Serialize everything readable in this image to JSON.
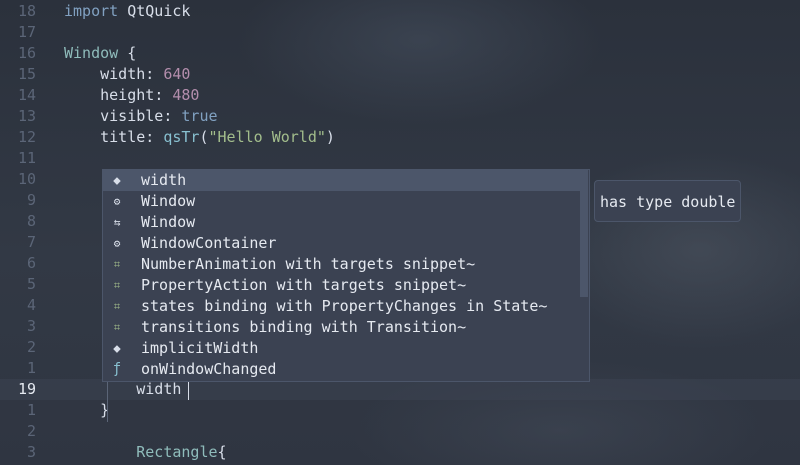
{
  "editor": {
    "lines": [
      {
        "number": "18",
        "tokens": [
          {
            "t": "kw",
            "v": "import"
          },
          {
            "t": "plain",
            "v": " QtQuick"
          }
        ]
      },
      {
        "number": "17",
        "tokens": []
      },
      {
        "number": "16",
        "tokens": [
          {
            "t": "ty",
            "v": "Window"
          },
          {
            "t": "plain",
            "v": " "
          },
          {
            "t": "punc",
            "v": "{"
          }
        ]
      },
      {
        "number": "15",
        "tokens": [
          {
            "t": "plain",
            "v": "    "
          },
          {
            "t": "prop",
            "v": "width"
          },
          {
            "t": "punc",
            "v": ": "
          },
          {
            "t": "num",
            "v": "640"
          }
        ]
      },
      {
        "number": "14",
        "tokens": [
          {
            "t": "plain",
            "v": "    "
          },
          {
            "t": "prop",
            "v": "height"
          },
          {
            "t": "punc",
            "v": ": "
          },
          {
            "t": "num",
            "v": "480"
          }
        ]
      },
      {
        "number": "13",
        "tokens": [
          {
            "t": "plain",
            "v": "    "
          },
          {
            "t": "prop",
            "v": "visible"
          },
          {
            "t": "punc",
            "v": ": "
          },
          {
            "t": "bool",
            "v": "true"
          }
        ]
      },
      {
        "number": "12",
        "tokens": [
          {
            "t": "plain",
            "v": "    "
          },
          {
            "t": "prop",
            "v": "title"
          },
          {
            "t": "punc",
            "v": ": "
          },
          {
            "t": "fn",
            "v": "qsTr"
          },
          {
            "t": "punc",
            "v": "("
          },
          {
            "t": "str",
            "v": "\"Hello World\""
          },
          {
            "t": "punc",
            "v": ")"
          }
        ]
      },
      {
        "number": "11",
        "tokens": []
      },
      {
        "number": "10",
        "tokens": []
      },
      {
        "number": "9",
        "tokens": []
      },
      {
        "number": "8",
        "tokens": []
      },
      {
        "number": "7",
        "tokens": []
      },
      {
        "number": "6",
        "tokens": []
      },
      {
        "number": "5",
        "tokens": []
      },
      {
        "number": "4",
        "tokens": []
      },
      {
        "number": "3",
        "tokens": []
      },
      {
        "number": "2",
        "tokens": []
      },
      {
        "number": "1",
        "tokens": []
      },
      {
        "number": "19",
        "current": true,
        "tokens": [
          {
            "t": "plain",
            "v": "        "
          },
          {
            "t": "prop",
            "v": "width"
          }
        ]
      },
      {
        "number": "1",
        "tokens": [
          {
            "t": "plain",
            "v": "    "
          },
          {
            "t": "punc",
            "v": "}"
          }
        ]
      },
      {
        "number": "2",
        "tokens": []
      },
      {
        "number": "3",
        "tokens": [
          {
            "t": "plain",
            "v": "        "
          },
          {
            "t": "ty",
            "v": "Rectangle"
          },
          {
            "t": "punc",
            "v": "{"
          }
        ]
      }
    ]
  },
  "completion": {
    "items": [
      {
        "kind": "property",
        "icon": "tag-icon",
        "glyph": "⬥",
        "label": "width",
        "selected": true
      },
      {
        "kind": "class",
        "icon": "gear-icon",
        "glyph": "⚙",
        "label": "Window"
      },
      {
        "kind": "struct",
        "icon": "struct-icon",
        "glyph": "⇆",
        "label": "Window"
      },
      {
        "kind": "class",
        "icon": "gear-icon",
        "glyph": "⚙",
        "label": "WindowContainer"
      },
      {
        "kind": "snippet",
        "icon": "snippet-icon",
        "glyph": "⌗",
        "label": "NumberAnimation with targets snippet~"
      },
      {
        "kind": "snippet",
        "icon": "snippet-icon",
        "glyph": "⌗",
        "label": "PropertyAction with targets snippet~"
      },
      {
        "kind": "snippet",
        "icon": "snippet-icon",
        "glyph": "⌗",
        "label": "states binding with PropertyChanges in State~"
      },
      {
        "kind": "snippet",
        "icon": "snippet-icon",
        "glyph": "⌗",
        "label": "transitions binding with Transition~"
      },
      {
        "kind": "property",
        "icon": "tag-icon",
        "glyph": "⬥",
        "label": "implicitWidth"
      },
      {
        "kind": "function",
        "icon": "function-icon",
        "glyph": "ƒ",
        "label": "onWindowChanged"
      }
    ]
  },
  "tooltip": {
    "text": "has type double"
  }
}
